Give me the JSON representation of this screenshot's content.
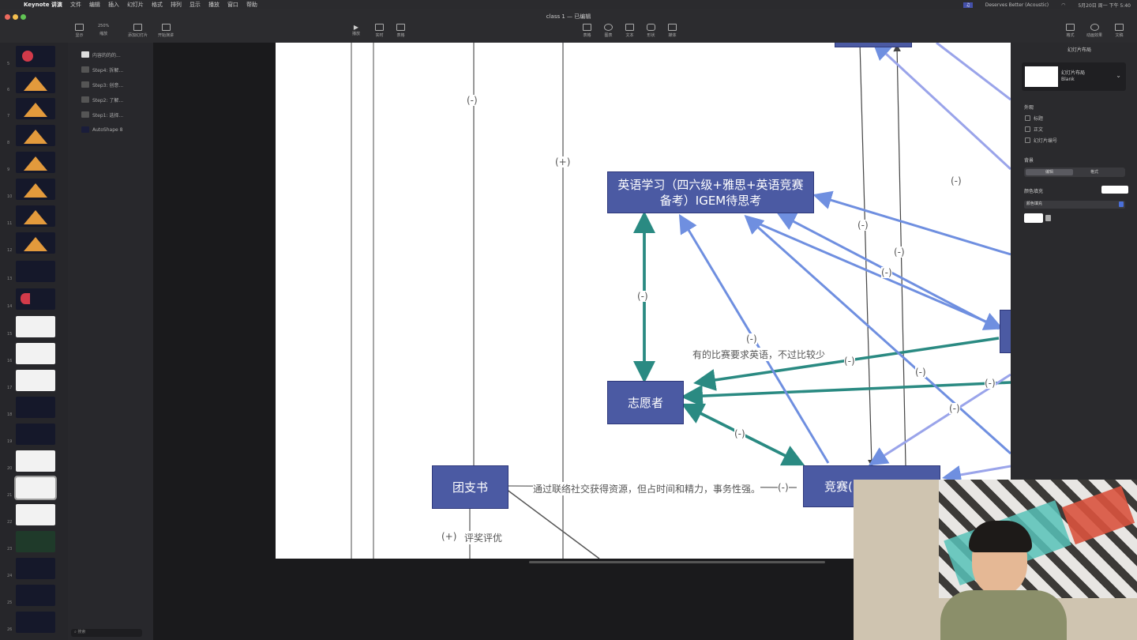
{
  "menubar": {
    "app": "Keynote 讲演",
    "items": [
      "文件",
      "编辑",
      "插入",
      "幻灯片",
      "格式",
      "排列",
      "显示",
      "播放",
      "窗口",
      "帮助"
    ],
    "now_playing": "Deserves Better (Acoustic)",
    "clock": "5月20日 周一 下午 5:40"
  },
  "toolbar": {
    "window_title": "class 1 — 已编辑",
    "left": [
      {
        "label": "显示"
      },
      {
        "label": "缩放"
      },
      {
        "label": "添加幻灯片"
      },
      {
        "label": "开始演讲"
      }
    ],
    "zoom": "250%",
    "center": [
      {
        "label": "播放"
      },
      {
        "label": "实时"
      },
      {
        "label": "表格"
      }
    ],
    "mid": [
      {
        "label": "表格"
      },
      {
        "label": "图表"
      },
      {
        "label": "文本"
      },
      {
        "label": "形状"
      },
      {
        "label": "媒体"
      }
    ],
    "right": [
      {
        "label": "格式"
      },
      {
        "label": "动画效果"
      },
      {
        "label": "文稿"
      }
    ]
  },
  "slides": {
    "numbers": [
      "5",
      "6",
      "7",
      "8",
      "9",
      "10",
      "11",
      "12",
      "13",
      "14",
      "15",
      "16",
      "17",
      "18",
      "19",
      "20",
      "21",
      "22",
      "23",
      "24",
      "25",
      "26",
      "27",
      "28",
      "29"
    ]
  },
  "layers": {
    "items": [
      {
        "label": "内容的的的..."
      },
      {
        "label": "Step4: 拆解..."
      },
      {
        "label": "Step3: 创意..."
      },
      {
        "label": "Step2: 了解..."
      },
      {
        "label": "Step1: 选择..."
      },
      {
        "label": "AutoShape 8"
      }
    ],
    "search_placeholder": "搜索"
  },
  "right_panel": {
    "tab": "幻灯片布局",
    "layout_name": "幻灯片布局",
    "layout_value": "Blank",
    "appearance_title": "外观",
    "checks": [
      "标题",
      "正文",
      "幻灯片编号"
    ],
    "background_title": "背景",
    "seg_left": "编辑",
    "seg_right": "格式",
    "fill_label": "颜色填充",
    "fill_value": "颜色填充"
  },
  "diagram": {
    "node_english": "英语学习（四六级+雅思+英语竞赛备考）IGEM待思考",
    "node_volunteer": "志愿者",
    "node_league": "团支书",
    "node_competition": "竞赛(",
    "edge_league_comp": "通过联络社交获得资源，但占时间和精力，事务性强。",
    "edge_some_comp": "有的比赛要求英语，不过比较少",
    "award": "评奖评优",
    "minus": "(-)",
    "plus": "(+)"
  },
  "colors": {
    "node_fill": "#4b5aa3",
    "teal": "#2a8a82",
    "blue_arrow": "#6f8fe0",
    "lilac_arrow": "#9aa4ea"
  }
}
